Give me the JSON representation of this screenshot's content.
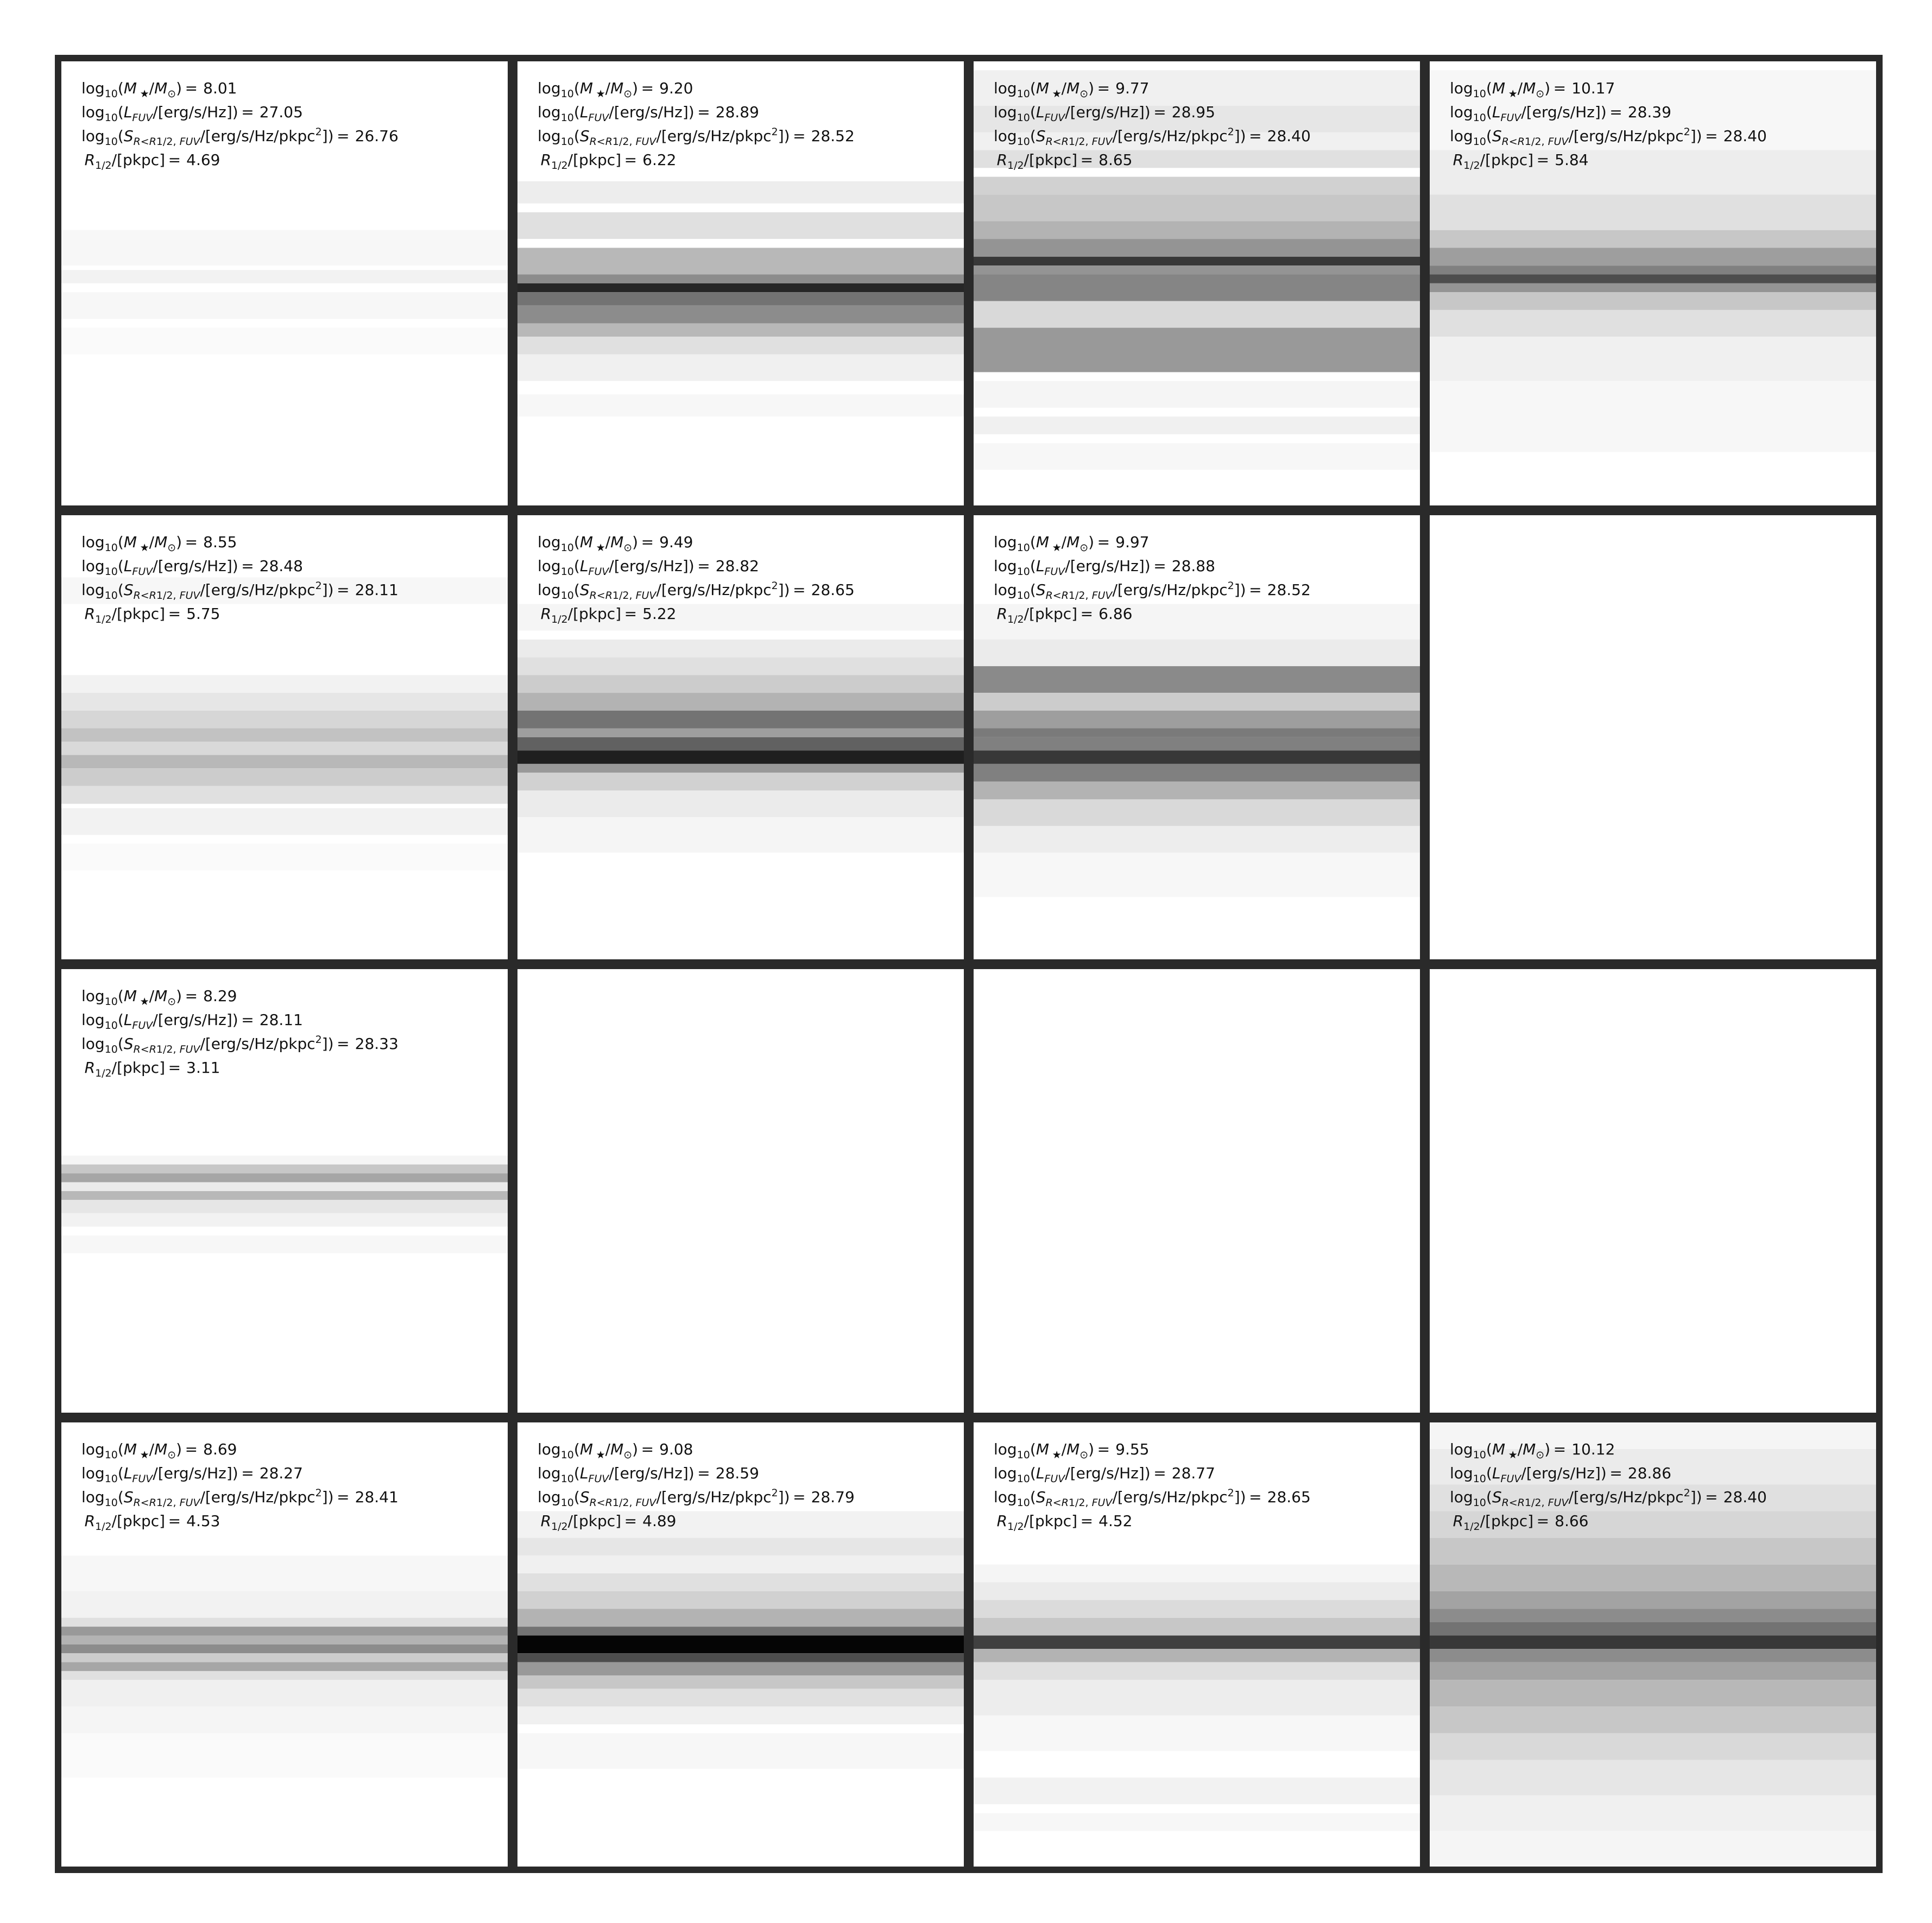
{
  "colors": {
    "frame": "#2a2a2a",
    "background": "#ffffff",
    "colormap": "grayscale (white = low, black = high)"
  },
  "chart_data": {
    "type": "heatmap",
    "layout": {
      "rows": 4,
      "cols": 4
    },
    "grid_lines": false,
    "panels": [
      {
        "row": 0,
        "col": 0,
        "empty": false,
        "values": {
          "log_mstar": "8.01",
          "log_lfuv": "27.05",
          "log_sfuv": "26.76",
          "r_half": "4.69"
        },
        "bands": [
          [
            0.38,
            0.46,
            0.03
          ],
          [
            0.47,
            0.5,
            0.05
          ],
          [
            0.52,
            0.58,
            0.03
          ],
          [
            0.6,
            0.66,
            0.02
          ]
        ]
      },
      {
        "row": 0,
        "col": 1,
        "empty": false,
        "values": {
          "log_mstar": "9.20",
          "log_lfuv": "28.89",
          "log_sfuv": "28.52",
          "r_half": "6.22"
        },
        "bands": [
          [
            0.27,
            0.32,
            0.07
          ],
          [
            0.34,
            0.4,
            0.12
          ],
          [
            0.42,
            0.48,
            0.28
          ],
          [
            0.48,
            0.5,
            0.45
          ],
          [
            0.5,
            0.52,
            0.85
          ],
          [
            0.52,
            0.55,
            0.55
          ],
          [
            0.55,
            0.59,
            0.45
          ],
          [
            0.59,
            0.62,
            0.28
          ],
          [
            0.62,
            0.66,
            0.12
          ],
          [
            0.66,
            0.72,
            0.06
          ],
          [
            0.75,
            0.8,
            0.03
          ]
        ]
      },
      {
        "row": 0,
        "col": 2,
        "empty": false,
        "values": {
          "log_mstar": "9.77",
          "log_lfuv": "28.95",
          "log_sfuv": "28.40",
          "r_half": "8.65"
        },
        "bands": [
          [
            0.02,
            0.1,
            0.06
          ],
          [
            0.1,
            0.16,
            0.1
          ],
          [
            0.16,
            0.2,
            0.06
          ],
          [
            0.2,
            0.24,
            0.12
          ],
          [
            0.26,
            0.3,
            0.18
          ],
          [
            0.3,
            0.36,
            0.22
          ],
          [
            0.36,
            0.4,
            0.3
          ],
          [
            0.4,
            0.44,
            0.42
          ],
          [
            0.44,
            0.46,
            0.78
          ],
          [
            0.46,
            0.48,
            0.42
          ],
          [
            0.48,
            0.54,
            0.48
          ],
          [
            0.54,
            0.6,
            0.15
          ],
          [
            0.6,
            0.7,
            0.4
          ],
          [
            0.72,
            0.78,
            0.04
          ],
          [
            0.8,
            0.84,
            0.06
          ],
          [
            0.86,
            0.92,
            0.03
          ]
        ]
      },
      {
        "row": 0,
        "col": 3,
        "empty": false,
        "values": {
          "log_mstar": "10.17",
          "log_lfuv": "28.39",
          "log_sfuv": "28.40",
          "r_half": "5.84"
        },
        "bands": [
          [
            0.02,
            0.2,
            0.03
          ],
          [
            0.2,
            0.3,
            0.07
          ],
          [
            0.3,
            0.38,
            0.12
          ],
          [
            0.38,
            0.42,
            0.22
          ],
          [
            0.42,
            0.46,
            0.38
          ],
          [
            0.46,
            0.48,
            0.5
          ],
          [
            0.48,
            0.5,
            0.7
          ],
          [
            0.5,
            0.52,
            0.42
          ],
          [
            0.52,
            0.56,
            0.22
          ],
          [
            0.56,
            0.62,
            0.12
          ],
          [
            0.62,
            0.72,
            0.06
          ],
          [
            0.72,
            0.88,
            0.03
          ]
        ]
      },
      {
        "row": 1,
        "col": 0,
        "empty": false,
        "values": {
          "log_mstar": "8.55",
          "log_lfuv": "28.48",
          "log_sfuv": "28.11",
          "r_half": "5.75"
        },
        "bands": [
          [
            0.14,
            0.2,
            0.03
          ],
          [
            0.36,
            0.4,
            0.05
          ],
          [
            0.4,
            0.44,
            0.1
          ],
          [
            0.44,
            0.48,
            0.16
          ],
          [
            0.48,
            0.51,
            0.24
          ],
          [
            0.51,
            0.54,
            0.15
          ],
          [
            0.54,
            0.57,
            0.28
          ],
          [
            0.57,
            0.61,
            0.2
          ],
          [
            0.61,
            0.65,
            0.12
          ],
          [
            0.66,
            0.72,
            0.05
          ],
          [
            0.74,
            0.8,
            0.02
          ]
        ]
      },
      {
        "row": 1,
        "col": 1,
        "empty": false,
        "values": {
          "log_mstar": "9.49",
          "log_lfuv": "28.82",
          "log_sfuv": "28.65",
          "r_half": "5.22"
        },
        "bands": [
          [
            0.2,
            0.26,
            0.04
          ],
          [
            0.28,
            0.32,
            0.08
          ],
          [
            0.32,
            0.36,
            0.12
          ],
          [
            0.36,
            0.4,
            0.2
          ],
          [
            0.4,
            0.44,
            0.3
          ],
          [
            0.44,
            0.48,
            0.55
          ],
          [
            0.48,
            0.5,
            0.38
          ],
          [
            0.5,
            0.53,
            0.62
          ],
          [
            0.53,
            0.56,
            0.88
          ],
          [
            0.56,
            0.58,
            0.4
          ],
          [
            0.58,
            0.62,
            0.18
          ],
          [
            0.62,
            0.68,
            0.08
          ],
          [
            0.68,
            0.76,
            0.04
          ]
        ]
      },
      {
        "row": 1,
        "col": 2,
        "empty": false,
        "values": {
          "log_mstar": "9.97",
          "log_lfuv": "28.88",
          "log_sfuv": "28.52",
          "r_half": "6.86"
        },
        "bands": [
          [
            0.2,
            0.28,
            0.04
          ],
          [
            0.28,
            0.34,
            0.08
          ],
          [
            0.34,
            0.4,
            0.46
          ],
          [
            0.4,
            0.44,
            0.2
          ],
          [
            0.44,
            0.48,
            0.38
          ],
          [
            0.48,
            0.5,
            0.52
          ],
          [
            0.5,
            0.53,
            0.5
          ],
          [
            0.53,
            0.56,
            0.78
          ],
          [
            0.56,
            0.6,
            0.5
          ],
          [
            0.6,
            0.64,
            0.3
          ],
          [
            0.64,
            0.7,
            0.15
          ],
          [
            0.7,
            0.76,
            0.07
          ],
          [
            0.76,
            0.86,
            0.03
          ]
        ]
      },
      {
        "row": 1,
        "col": 3,
        "empty": true,
        "bands": []
      },
      {
        "row": 2,
        "col": 0,
        "empty": false,
        "values": {
          "log_mstar": "8.29",
          "log_lfuv": "28.11",
          "log_sfuv": "28.33",
          "r_half": "3.11"
        },
        "bands": [
          [
            0.42,
            0.44,
            0.04
          ],
          [
            0.44,
            0.46,
            0.22
          ],
          [
            0.46,
            0.48,
            0.35
          ],
          [
            0.48,
            0.5,
            0.08
          ],
          [
            0.5,
            0.52,
            0.28
          ],
          [
            0.52,
            0.55,
            0.1
          ],
          [
            0.55,
            0.58,
            0.05
          ],
          [
            0.6,
            0.64,
            0.03
          ]
        ]
      },
      {
        "row": 2,
        "col": 1,
        "empty": true,
        "bands": []
      },
      {
        "row": 2,
        "col": 2,
        "empty": true,
        "bands": []
      },
      {
        "row": 2,
        "col": 3,
        "empty": true,
        "bands": []
      },
      {
        "row": 3,
        "col": 0,
        "empty": false,
        "values": {
          "log_mstar": "8.69",
          "log_lfuv": "28.27",
          "log_sfuv": "28.41",
          "r_half": "4.53"
        },
        "bands": [
          [
            0.3,
            0.38,
            0.03
          ],
          [
            0.38,
            0.44,
            0.05
          ],
          [
            0.44,
            0.46,
            0.12
          ],
          [
            0.46,
            0.48,
            0.4
          ],
          [
            0.48,
            0.5,
            0.3
          ],
          [
            0.5,
            0.52,
            0.45
          ],
          [
            0.52,
            0.54,
            0.2
          ],
          [
            0.54,
            0.56,
            0.35
          ],
          [
            0.56,
            0.58,
            0.12
          ],
          [
            0.58,
            0.64,
            0.06
          ],
          [
            0.64,
            0.7,
            0.04
          ],
          [
            0.7,
            0.8,
            0.02
          ]
        ]
      },
      {
        "row": 3,
        "col": 1,
        "empty": false,
        "values": {
          "log_mstar": "9.08",
          "log_lfuv": "28.59",
          "log_sfuv": "28.79",
          "r_half": "4.89"
        },
        "bands": [
          [
            0.2,
            0.26,
            0.05
          ],
          [
            0.26,
            0.3,
            0.1
          ],
          [
            0.3,
            0.34,
            0.06
          ],
          [
            0.34,
            0.38,
            0.12
          ],
          [
            0.38,
            0.42,
            0.18
          ],
          [
            0.42,
            0.46,
            0.3
          ],
          [
            0.46,
            0.48,
            0.55
          ],
          [
            0.48,
            0.52,
            0.98
          ],
          [
            0.52,
            0.54,
            0.7
          ],
          [
            0.54,
            0.57,
            0.4
          ],
          [
            0.57,
            0.6,
            0.22
          ],
          [
            0.6,
            0.64,
            0.12
          ],
          [
            0.64,
            0.68,
            0.06
          ],
          [
            0.7,
            0.78,
            0.03
          ]
        ]
      },
      {
        "row": 3,
        "col": 2,
        "empty": false,
        "values": {
          "log_mstar": "9.55",
          "log_lfuv": "28.77",
          "log_sfuv": "28.65",
          "r_half": "4.52"
        },
        "bands": [
          [
            0.32,
            0.36,
            0.04
          ],
          [
            0.36,
            0.4,
            0.08
          ],
          [
            0.4,
            0.44,
            0.14
          ],
          [
            0.44,
            0.48,
            0.22
          ],
          [
            0.48,
            0.51,
            0.75
          ],
          [
            0.51,
            0.54,
            0.3
          ],
          [
            0.54,
            0.58,
            0.12
          ],
          [
            0.58,
            0.66,
            0.07
          ],
          [
            0.66,
            0.74,
            0.03
          ],
          [
            0.8,
            0.86,
            0.05
          ],
          [
            0.88,
            0.92,
            0.03
          ]
        ]
      },
      {
        "row": 3,
        "col": 3,
        "empty": false,
        "values": {
          "log_mstar": "10.12",
          "log_lfuv": "28.86",
          "log_sfuv": "28.40",
          "r_half": "8.66"
        },
        "bands": [
          [
            0.0,
            0.06,
            0.04
          ],
          [
            0.06,
            0.14,
            0.08
          ],
          [
            0.14,
            0.2,
            0.12
          ],
          [
            0.2,
            0.26,
            0.16
          ],
          [
            0.26,
            0.32,
            0.22
          ],
          [
            0.32,
            0.38,
            0.28
          ],
          [
            0.38,
            0.42,
            0.36
          ],
          [
            0.42,
            0.45,
            0.45
          ],
          [
            0.45,
            0.48,
            0.55
          ],
          [
            0.48,
            0.51,
            0.78
          ],
          [
            0.51,
            0.54,
            0.45
          ],
          [
            0.54,
            0.58,
            0.36
          ],
          [
            0.58,
            0.64,
            0.28
          ],
          [
            0.64,
            0.7,
            0.22
          ],
          [
            0.7,
            0.76,
            0.15
          ],
          [
            0.76,
            0.84,
            0.1
          ],
          [
            0.84,
            0.92,
            0.06
          ],
          [
            0.92,
            1.0,
            0.04
          ]
        ]
      }
    ]
  }
}
